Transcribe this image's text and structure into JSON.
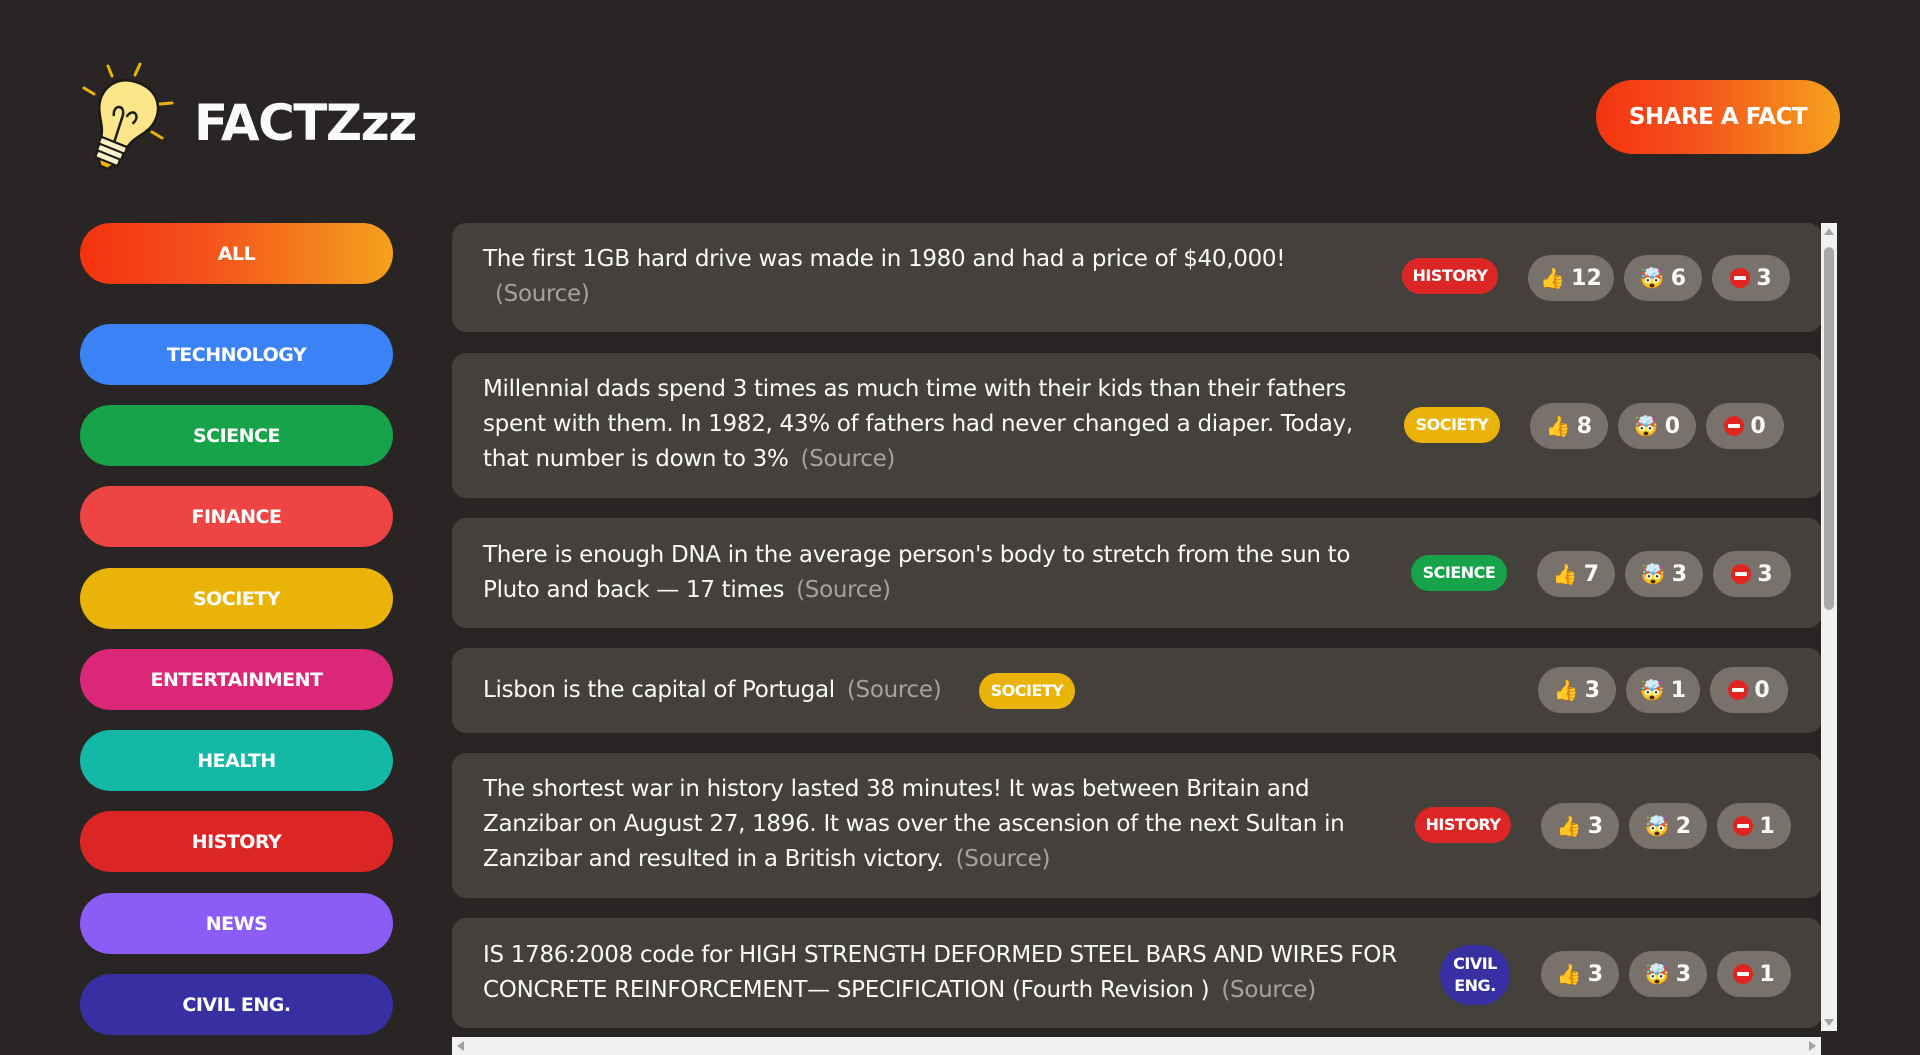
{
  "app": {
    "title": "FACTZzz",
    "share_label": "SHARE A FACT"
  },
  "categories": [
    {
      "label": "ALL",
      "color": "gradient"
    },
    {
      "label": "TECHNOLOGY",
      "color": "#3b82f6"
    },
    {
      "label": "SCIENCE",
      "color": "#16a34a"
    },
    {
      "label": "FINANCE",
      "color": "#ef4444"
    },
    {
      "label": "SOCIETY",
      "color": "#eab308"
    },
    {
      "label": "ENTERTAINMENT",
      "color": "#db2777"
    },
    {
      "label": "HEALTH",
      "color": "#14b8a6"
    },
    {
      "label": "HISTORY",
      "color": "#dc2626"
    },
    {
      "label": "NEWS",
      "color": "#8b5cf6"
    },
    {
      "label": "CIVIL ENG.",
      "color": "#3730a3"
    }
  ],
  "facts": [
    {
      "text": "The first 1GB hard drive was made in 1980 and had a price of $40,000!",
      "source_label": "(Source)",
      "category": "HISTORY",
      "votes": {
        "interesting": 12,
        "mindblowing": 6,
        "false": 3
      }
    },
    {
      "text": "Millennial dads spend 3 times as much time with their kids than their fathers spent with them. In 1982, 43% of fathers had never changed a diaper. Today, that number is down to 3%",
      "source_label": "(Source)",
      "category": "SOCIETY",
      "votes": {
        "interesting": 8,
        "mindblowing": 0,
        "false": 0
      }
    },
    {
      "text": "There is enough DNA in the average person's body to stretch from the sun to Pluto and back — 17 times",
      "source_label": "(Source)",
      "category": "SCIENCE",
      "votes": {
        "interesting": 7,
        "mindblowing": 3,
        "false": 3
      }
    },
    {
      "text": "Lisbon is the capital of Portugal",
      "source_label": "(Source)",
      "category": "SOCIETY",
      "votes": {
        "interesting": 3,
        "mindblowing": 1,
        "false": 0
      }
    },
    {
      "text": "The shortest war in history lasted 38 minutes! It was between Britain and Zanzibar on August 27, 1896. It was over the ascension of the next Sultan in Zanzibar and resulted in a British victory.",
      "source_label": "(Source)",
      "category": "HISTORY",
      "votes": {
        "interesting": 3,
        "mindblowing": 2,
        "false": 1
      }
    },
    {
      "text": "IS 1786:2008 code for HIGH STRENGTH DEFORMED STEEL BARS AND WIRES FOR CONCRETE REINFORCEMENT— SPECIFICATION (Fourth Revision )",
      "source_label": "(Source)",
      "category": "CIVIL ENG.",
      "votes": {
        "interesting": 3,
        "mindblowing": 3,
        "false": 1
      }
    }
  ],
  "icons": {
    "logo": "lightbulb-icon",
    "interesting": "thumbs-up-icon",
    "mindblowing": "mind-blown-icon",
    "false": "no-entry-icon"
  }
}
